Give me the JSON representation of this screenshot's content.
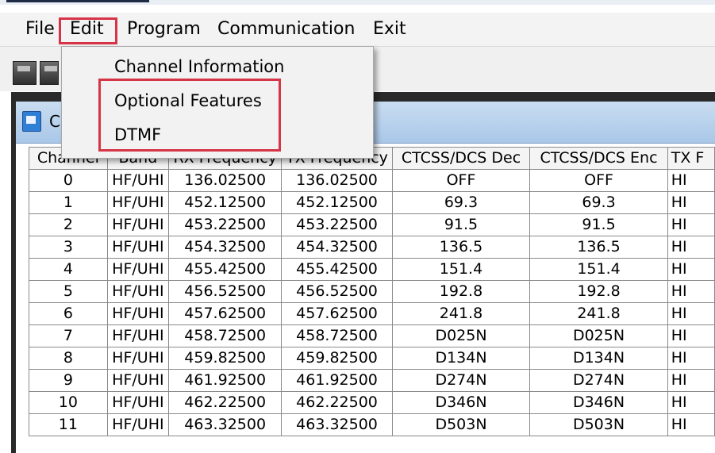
{
  "menubar": {
    "file": "File",
    "edit": "Edit",
    "program": "Program",
    "communication": "Communication",
    "exit": "Exit"
  },
  "edit_menu": {
    "items": [
      "Channel Information",
      "Optional Features",
      "DTMF"
    ],
    "highlighted": [
      "Optional Features",
      "DTMF"
    ]
  },
  "child_window": {
    "title": "C"
  },
  "table": {
    "columns": [
      "Channel",
      "Band",
      "RX Frequency",
      "TX Frequency",
      "CTCSS/DCS Dec",
      "CTCSS/DCS Enc",
      "TX F"
    ],
    "rows": [
      [
        "0",
        "HF/UHI",
        "136.02500",
        "136.02500",
        "OFF",
        "OFF",
        "HI"
      ],
      [
        "1",
        "HF/UHI",
        "452.12500",
        "452.12500",
        "69.3",
        "69.3",
        "HI"
      ],
      [
        "2",
        "HF/UHI",
        "453.22500",
        "453.22500",
        "91.5",
        "91.5",
        "HI"
      ],
      [
        "3",
        "HF/UHI",
        "454.32500",
        "454.32500",
        "136.5",
        "136.5",
        "HI"
      ],
      [
        "4",
        "HF/UHI",
        "455.42500",
        "455.42500",
        "151.4",
        "151.4",
        "HI"
      ],
      [
        "5",
        "HF/UHI",
        "456.52500",
        "456.52500",
        "192.8",
        "192.8",
        "HI"
      ],
      [
        "6",
        "HF/UHI",
        "457.62500",
        "457.62500",
        "241.8",
        "241.8",
        "HI"
      ],
      [
        "7",
        "HF/UHI",
        "458.72500",
        "458.72500",
        "D025N",
        "D025N",
        "HI"
      ],
      [
        "8",
        "HF/UHI",
        "459.82500",
        "459.82500",
        "D134N",
        "D134N",
        "HI"
      ],
      [
        "9",
        "HF/UHI",
        "461.92500",
        "461.92500",
        "D274N",
        "D274N",
        "HI"
      ],
      [
        "10",
        "HF/UHI",
        "462.22500",
        "462.22500",
        "D346N",
        "D346N",
        "HI"
      ],
      [
        "11",
        "HF/UHI",
        "463.32500",
        "463.32500",
        "D503N",
        "D503N",
        "HI"
      ]
    ]
  },
  "colors": {
    "highlight_outline": "#d63447",
    "titlebar": "#a9c7e8"
  },
  "icons": {
    "toolbar": [
      "save-icon",
      "open-icon"
    ],
    "child_window": "window-app-icon"
  }
}
